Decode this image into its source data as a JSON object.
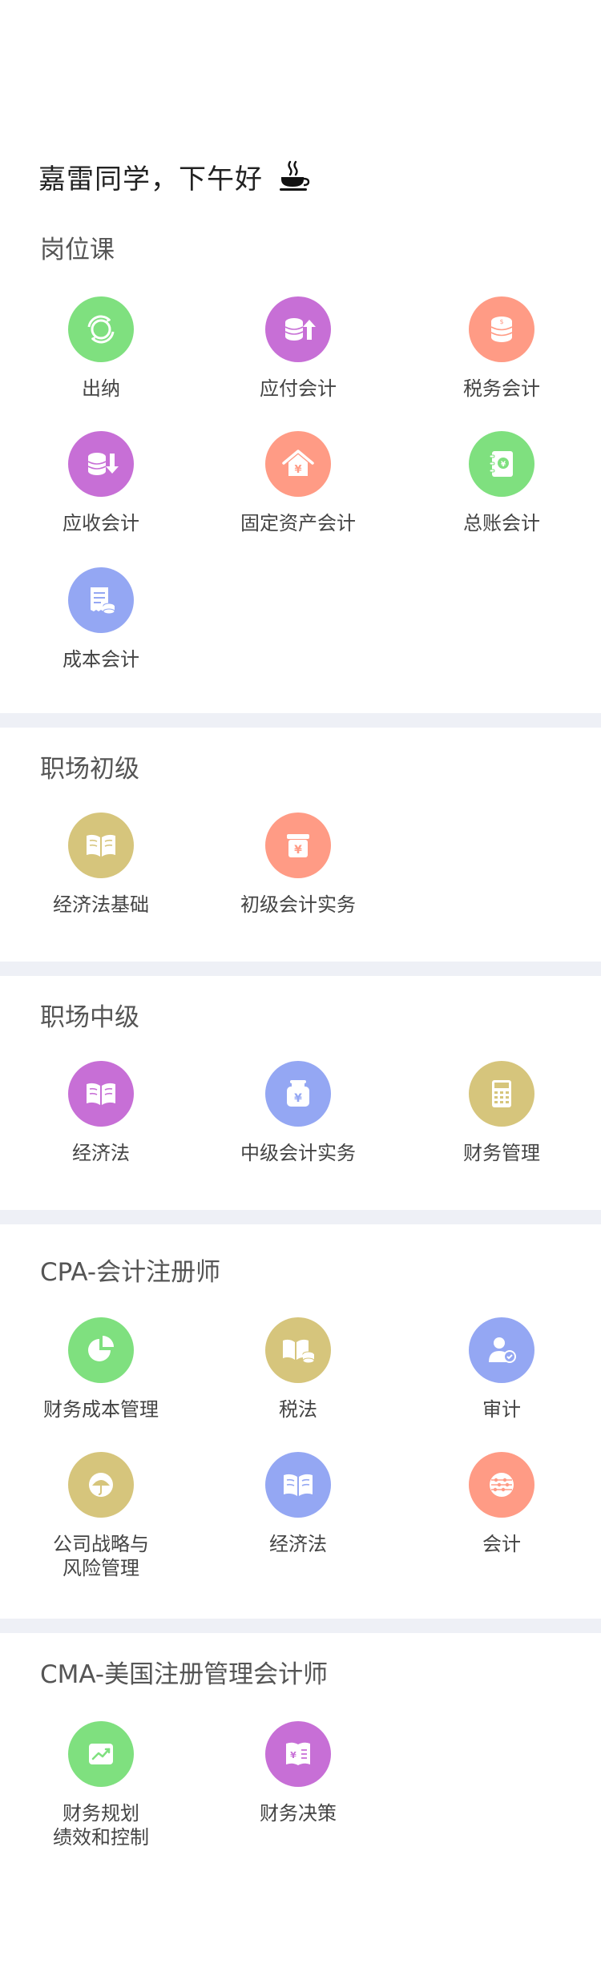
{
  "greeting": {
    "text": "嘉雷同学，下午好"
  },
  "colors": {
    "green": "#7fe07f",
    "purple": "#c76fd6",
    "coral": "#ff9b85",
    "blue": "#94a7f3",
    "gold": "#d6c57c",
    "divider": "#eef0f6"
  },
  "sections": {
    "s1": {
      "title": "岗位课",
      "items": [
        {
          "label": "出纳",
          "icon": "cashier-icon"
        },
        {
          "label": "应付会计",
          "icon": "coins-up-icon"
        },
        {
          "label": "税务会计",
          "icon": "coin-stack-icon"
        },
        {
          "label": "应收会计",
          "icon": "coins-down-icon"
        },
        {
          "label": "固定资产会计",
          "icon": "house-yen-icon"
        },
        {
          "label": "总账会计",
          "icon": "ledger-icon"
        },
        {
          "label": "成本会计",
          "icon": "receipt-icon"
        }
      ]
    },
    "s2": {
      "title": "职场初级",
      "items": [
        {
          "label": "经济法基础",
          "icon": "open-book-icon"
        },
        {
          "label": "初级会计实务",
          "icon": "yen-box-icon"
        }
      ]
    },
    "s3": {
      "title": "职场中级",
      "items": [
        {
          "label": "经济法",
          "icon": "open-book-icon"
        },
        {
          "label": "中级会计实务",
          "icon": "yen-jar-icon"
        },
        {
          "label": "财务管理",
          "icon": "calculator-icon"
        }
      ]
    },
    "s4": {
      "title": "CPA-会计注册师",
      "items": [
        {
          "label": "财务成本管理",
          "icon": "pie-chart-icon"
        },
        {
          "label": "税法",
          "icon": "book-coins-icon"
        },
        {
          "label": "审计",
          "icon": "auditor-icon"
        },
        {
          "label": "公司战略与\n风险管理",
          "icon": "umbrella-icon"
        },
        {
          "label": "经济法",
          "icon": "open-book-icon"
        },
        {
          "label": "会计",
          "icon": "abacus-icon"
        }
      ]
    },
    "s5": {
      "title": "CMA-美国注册管理会计师",
      "items": [
        {
          "label": "财务规划\n绩效和控制",
          "icon": "trend-icon"
        },
        {
          "label": "财务决策",
          "icon": "yen-doc-icon"
        }
      ]
    }
  }
}
